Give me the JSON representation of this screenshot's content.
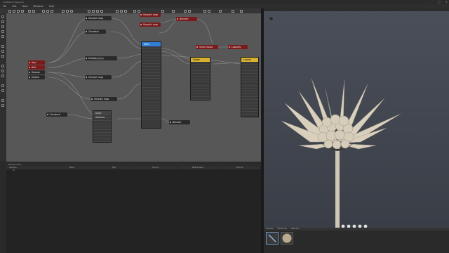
{
  "window": {
    "title": "Substance Designer",
    "controls": [
      "–",
      "□",
      "×"
    ]
  },
  "menu": {
    "items": [
      "File",
      "Edit",
      "Tools",
      "Windows",
      "Help"
    ]
  },
  "graph": {
    "nodes": {
      "age": "Age",
      "roll": "Roll",
      "season": "Season",
      "health": "Health",
      "smooth_map_1": "Smooth map",
      "constant_1": "Constant",
      "multiply": "Multiply (x/y)",
      "smooth_map_2": "Smooth map",
      "smooth_map_3": "Smooth map",
      "constant_2": "Constant",
      "smooth_map_red_1": "Smooth map",
      "smooth_map_red_2": "Smooth map",
      "blender": "Blender",
      "small_noise": "Small Noise",
      "lowpoly": "Lowpoly",
      "blender_dark": "Blender"
    },
    "panels": {
      "stem": "Stem",
      "input_selector": "Input Selector",
      "flower": "Flower",
      "leaves": "Leaves"
    }
  },
  "attributes": {
    "header": "Attributes Editor",
    "columns": [
      "Attribute",
      "Name",
      "Type",
      "Binding",
      "Default Value",
      "Channel"
    ],
    "row_label": "fld"
  },
  "shelf": {
    "tabs": [
      "Samples",
      "Substances",
      "Materials"
    ]
  }
}
